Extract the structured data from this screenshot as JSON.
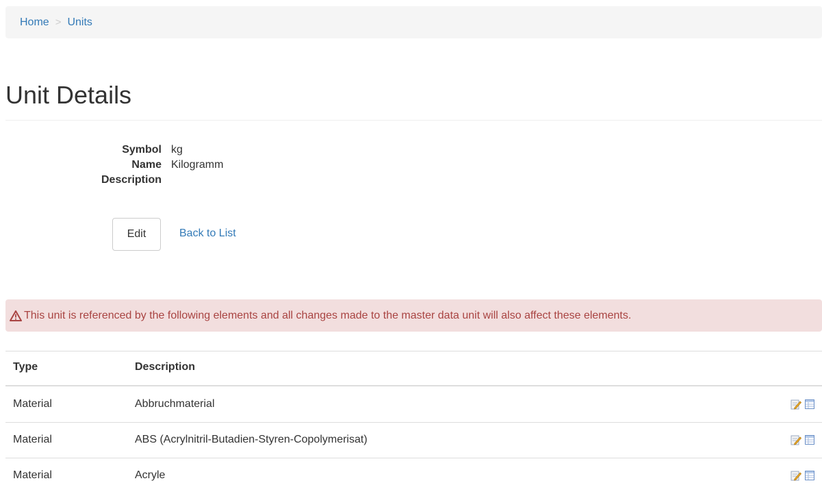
{
  "breadcrumb": {
    "home": "Home",
    "separator": ">",
    "current": "Units"
  },
  "page_title": "Unit Details",
  "details": [
    {
      "label": "Symbol",
      "value": "kg"
    },
    {
      "label": "Name",
      "value": "Kilogramm"
    },
    {
      "label": "Description",
      "value": ""
    }
  ],
  "actions": {
    "edit_label": "Edit",
    "back_label": "Back to List"
  },
  "alert": {
    "icon": "warning-triangle-icon",
    "text": "This unit is referenced by the following elements and all changes made to the master data unit will also affect these elements."
  },
  "table": {
    "headers": [
      "Type",
      "Description"
    ],
    "rows": [
      {
        "type": "Material",
        "description": "Abbruchmaterial"
      },
      {
        "type": "Material",
        "description": "ABS (Acrylnitril-Butadien-Styren-Copolymerisat)"
      },
      {
        "type": "Material",
        "description": "Acryle"
      }
    ],
    "row_icons": [
      "edit-icon",
      "details-icon"
    ]
  },
  "colors": {
    "link": "#337ab7",
    "alert_bg": "#f2dede",
    "alert_text": "#a94442",
    "breadcrumb_bg": "#f5f5f5"
  }
}
